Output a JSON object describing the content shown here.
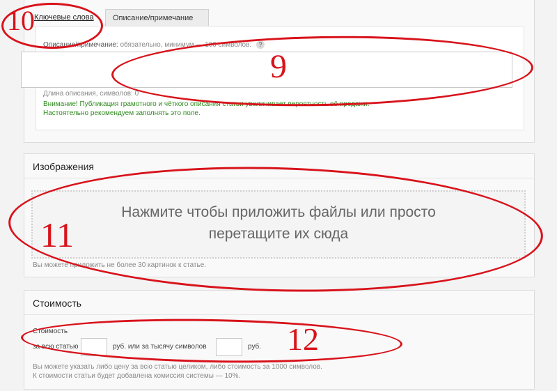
{
  "tabs": [
    {
      "label": "Ключевые слова",
      "active": true
    },
    {
      "label": "Описание/примечание",
      "active": false
    }
  ],
  "description": {
    "label": "Описание/примечание:",
    "hint": "обязательно, минимум — 100 символов.",
    "help": "?",
    "value": "",
    "length_text": "Длина описания, символов: 0",
    "warning_line1": "Внимание! Публикация грамотного и чёткого описания статьи увеличивает вероятность её продажи.",
    "warning_line2": "Настоятельно рекомендуем заполнять это поле."
  },
  "images": {
    "title": "Изображения",
    "dropzone_line1": "Нажмите чтобы приложить файлы или просто",
    "dropzone_line2": "перетащите их сюда",
    "note": "Вы можете приложить не более 30 картинок к статье."
  },
  "cost": {
    "title": "Стоимость",
    "label": "Стоимость",
    "whole_prefix": "за всю статью",
    "whole_value": "",
    "middle_text": "руб. или за тысячу символов",
    "per1000_value": "",
    "suffix": "руб.",
    "note1": "Вы можете указать либо цену за всю статью целиком, либо стоимость за 1000 символов.",
    "note2": "К стоимости статьи будет добавлена комиссия системы — 10%."
  },
  "annotations": {
    "n9": "9",
    "n10": "10",
    "n11": "11",
    "n12": "12",
    "color": "#d8131b"
  }
}
